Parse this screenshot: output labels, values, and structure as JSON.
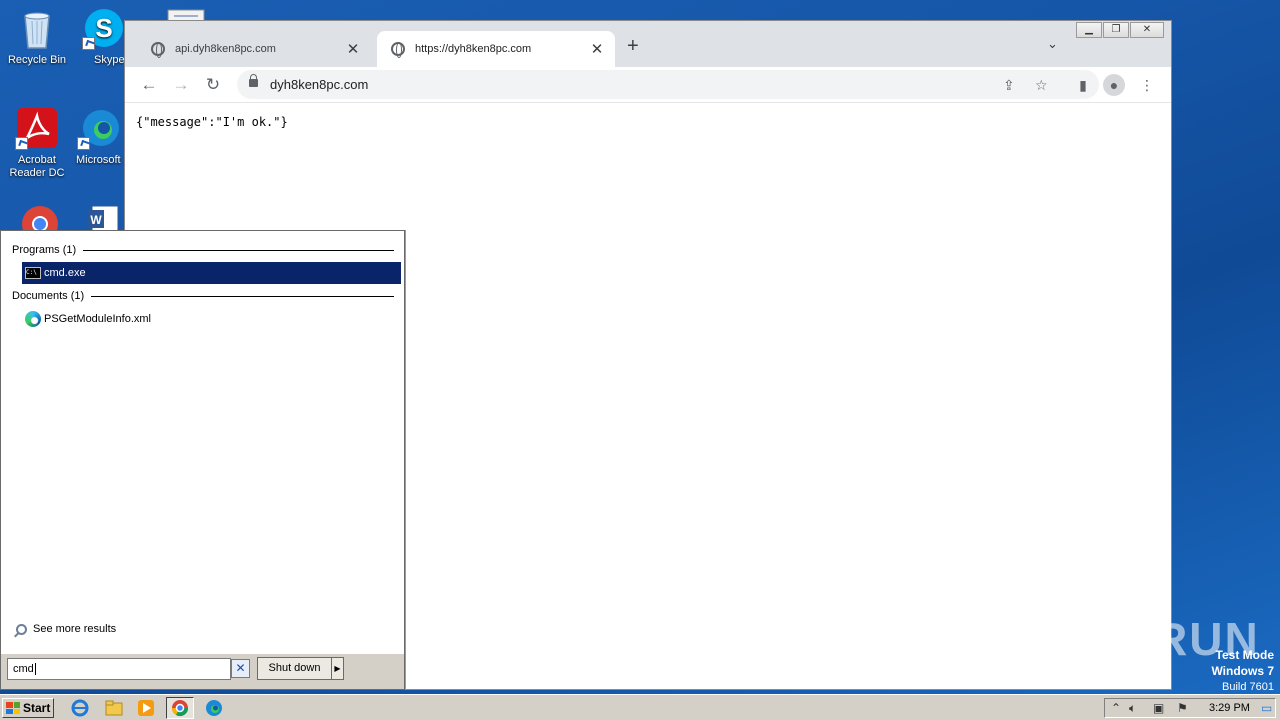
{
  "desktop": {
    "icons": [
      {
        "label": "Recycle Bin"
      },
      {
        "label": "Skype"
      },
      {
        "label": "Acrobat Reader DC"
      },
      {
        "label": "Microsoft"
      }
    ]
  },
  "browser": {
    "tabs": [
      {
        "title": "api.dyh8ken8pc.com"
      },
      {
        "title": "https://dyh8ken8pc.com"
      }
    ],
    "address": "dyh8ken8pc.com",
    "content": "{\"message\":\"I'm ok.\"}"
  },
  "start_menu": {
    "programs_header": "Programs (1)",
    "programs": [
      {
        "label": "cmd.exe"
      }
    ],
    "documents_header": "Documents (1)",
    "documents": [
      {
        "label": "PSGetModuleInfo.xml"
      }
    ],
    "see_more": "See more results",
    "search_value": "cmd",
    "shutdown_label": "Shut down"
  },
  "taskbar": {
    "start_label": "Start",
    "clock": "3:29 PM"
  },
  "watermark": {
    "brand": "ANY RUN",
    "test_mode": "Test Mode",
    "os": "Windows 7",
    "build": "Build 7601"
  },
  "colors": {
    "desktop": "#1656a8",
    "selection": "#0a246a",
    "taskbar": "#d4d0c8",
    "tabstrip": "#dee1e6"
  }
}
